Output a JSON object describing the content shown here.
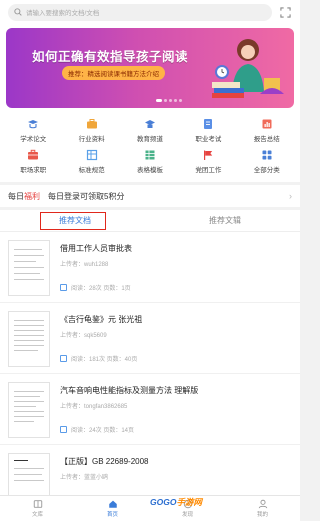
{
  "search": {
    "placeholder": "请输入要搜索的文档/文档"
  },
  "banner": {
    "title": "如何正确有效指导孩子阅读",
    "subtitle": "推荐：精选阅读课书籍方法介绍"
  },
  "categories": [
    {
      "label": "学术论文",
      "icon": "graduation-cap-icon",
      "color": "#4a7fd6"
    },
    {
      "label": "行业资料",
      "icon": "briefcase-icon",
      "color": "#f0a63a"
    },
    {
      "label": "教育频道",
      "icon": "mortarboard-icon",
      "color": "#4a7fd6"
    },
    {
      "label": "职业考试",
      "icon": "exam-icon",
      "color": "#5a8fe6"
    },
    {
      "label": "报告总结",
      "icon": "report-icon",
      "color": "#f06b5a"
    },
    {
      "label": "职场求职",
      "icon": "job-icon",
      "color": "#e8584a"
    },
    {
      "label": "标准规范",
      "icon": "ruler-icon",
      "color": "#5aa0e8"
    },
    {
      "label": "表格模板",
      "icon": "table-icon",
      "color": "#4ab28a"
    },
    {
      "label": "党团工作",
      "icon": "flag-icon",
      "color": "#e64340"
    },
    {
      "label": "全部分类",
      "icon": "grid-icon",
      "color": "#4a7fd6"
    }
  ],
  "welfare": {
    "prefix": "每日",
    "highlight": "福利",
    "text": "每日登录可领取5积分"
  },
  "tabs": [
    {
      "label": "推荐文档",
      "active": true
    },
    {
      "label": "推荐文辑",
      "active": false
    }
  ],
  "documents": [
    {
      "title": "借用工作人员审批表",
      "uploader": "上传者：wuh1288",
      "meta": "阅读：28次  页数：1页"
    },
    {
      "title": "《吉行龟鉴》元 张光祖",
      "uploader": "上传者：sqk5609",
      "meta": "阅读：181次  页数：40页"
    },
    {
      "title": "汽车音响电性能指标及测量方法 理解版",
      "uploader": "上传者：tongfan3862685",
      "meta": "阅读：24次  页数：14页"
    },
    {
      "title": "【正版】GB 22689-2008",
      "uploader": "上传者：蓝蓝小鸥",
      "meta": ""
    }
  ],
  "nav": [
    {
      "label": "文库",
      "icon": "library-icon"
    },
    {
      "label": "首页",
      "icon": "home-icon",
      "active": true
    },
    {
      "label": "发现",
      "icon": "discover-icon"
    },
    {
      "label": "我的",
      "icon": "user-icon"
    }
  ],
  "watermark": {
    "a": "GOGO",
    "b": "手游网"
  }
}
